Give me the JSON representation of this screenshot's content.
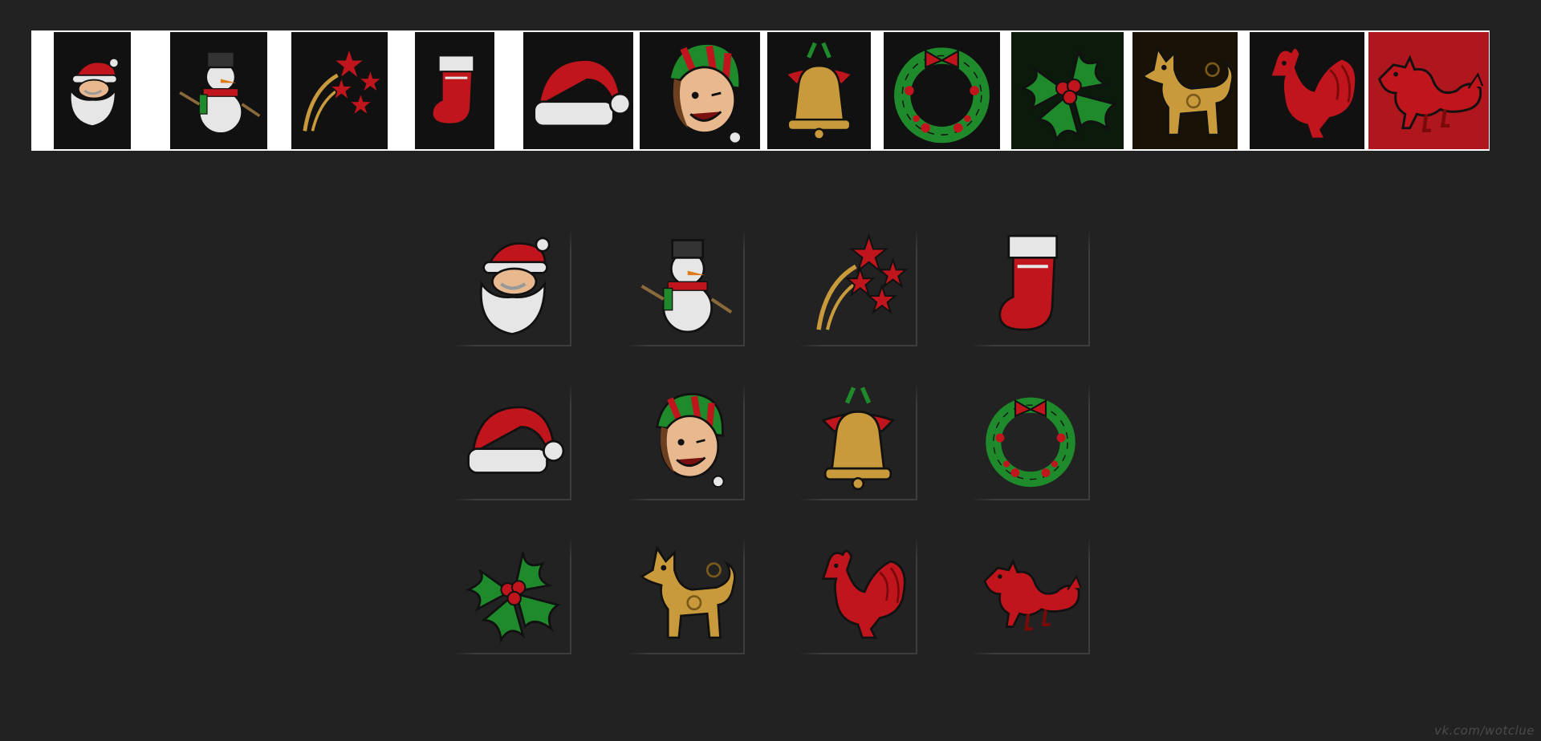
{
  "strip": {
    "items": [
      {
        "icon": "santa-icon"
      },
      {
        "icon": "snowman-icon"
      },
      {
        "icon": "shooting-stars-icon"
      },
      {
        "icon": "stocking-icon"
      },
      {
        "icon": "santa-hat-icon"
      },
      {
        "icon": "elf-icon"
      },
      {
        "icon": "bell-icon"
      },
      {
        "icon": "wreath-icon"
      },
      {
        "icon": "holly-icon"
      },
      {
        "icon": "golden-dog-icon"
      },
      {
        "icon": "red-rooster-icon"
      },
      {
        "icon": "red-dragon-icon"
      }
    ]
  },
  "grid": {
    "rows": [
      [
        "santa-icon",
        "snowman-icon",
        "shooting-stars-icon",
        "stocking-icon"
      ],
      [
        "santa-hat-icon",
        "elf-icon",
        "bell-icon",
        "wreath-icon"
      ],
      [
        "holly-icon",
        "golden-dog-icon",
        "red-rooster-icon",
        "red-dragon-icon"
      ]
    ]
  },
  "colors": {
    "background": "#222222",
    "strip_background": "#ffffff",
    "red": "#c0151c",
    "green": "#1f8a2b",
    "gold": "#c99a3b",
    "white": "#e6e6e6"
  },
  "watermark": "vk.com/wotclue"
}
